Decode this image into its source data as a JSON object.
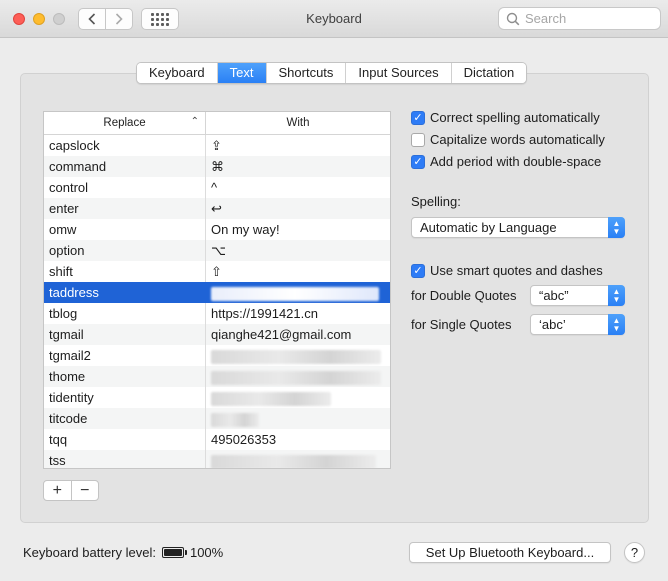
{
  "window": {
    "title": "Keyboard"
  },
  "search": {
    "placeholder": "Search"
  },
  "tabs": [
    "Keyboard",
    "Text",
    "Shortcuts",
    "Input Sources",
    "Dictation"
  ],
  "active_tab": "Text",
  "table": {
    "headers": {
      "replace": "Replace",
      "with": "With"
    },
    "rows": [
      {
        "replace": "capslock",
        "with": "⇪"
      },
      {
        "replace": "command",
        "with": "⌘"
      },
      {
        "replace": "control",
        "with": "^"
      },
      {
        "replace": "enter",
        "with": "↩"
      },
      {
        "replace": "omw",
        "with": "On my way!"
      },
      {
        "replace": "option",
        "with": "⌥"
      },
      {
        "replace": "shift",
        "with": "⇧"
      },
      {
        "replace": "taddress",
        "with": ""
      },
      {
        "replace": "tblog",
        "with": "https://1991421.cn"
      },
      {
        "replace": "tgmail",
        "with": "qianghe421@gmail.com"
      },
      {
        "replace": "tgmail2",
        "with": ""
      },
      {
        "replace": "thome",
        "with": ""
      },
      {
        "replace": "tidentity",
        "with": ""
      },
      {
        "replace": "titcode",
        "with": ""
      },
      {
        "replace": "tqq",
        "with": "495026353"
      },
      {
        "replace": "tss",
        "with": ""
      }
    ],
    "selected_row": "taddress"
  },
  "table_buttons": {
    "add": "+",
    "remove": "−"
  },
  "options": {
    "correct_spelling": {
      "label": "Correct spelling automatically",
      "checked": true
    },
    "capitalize_words": {
      "label": "Capitalize words automatically",
      "checked": false
    },
    "add_period": {
      "label": "Add period with double-space",
      "checked": true
    },
    "spelling_label": "Spelling:",
    "spelling_value": "Automatic by Language",
    "smart_quotes": {
      "label": "Use smart quotes and dashes",
      "checked": true
    },
    "double_quotes_label": "for Double Quotes",
    "double_quotes_value": "“abc”",
    "single_quotes_label": "for Single Quotes",
    "single_quotes_value": "‘abc’"
  },
  "footer": {
    "battery_label": "Keyboard battery level:",
    "battery_value": "100%",
    "setup_button": "Set Up Bluetooth Keyboard...",
    "help": "?"
  },
  "colors": {
    "accent": "#2e7cf6",
    "selection": "#1f63d6"
  }
}
